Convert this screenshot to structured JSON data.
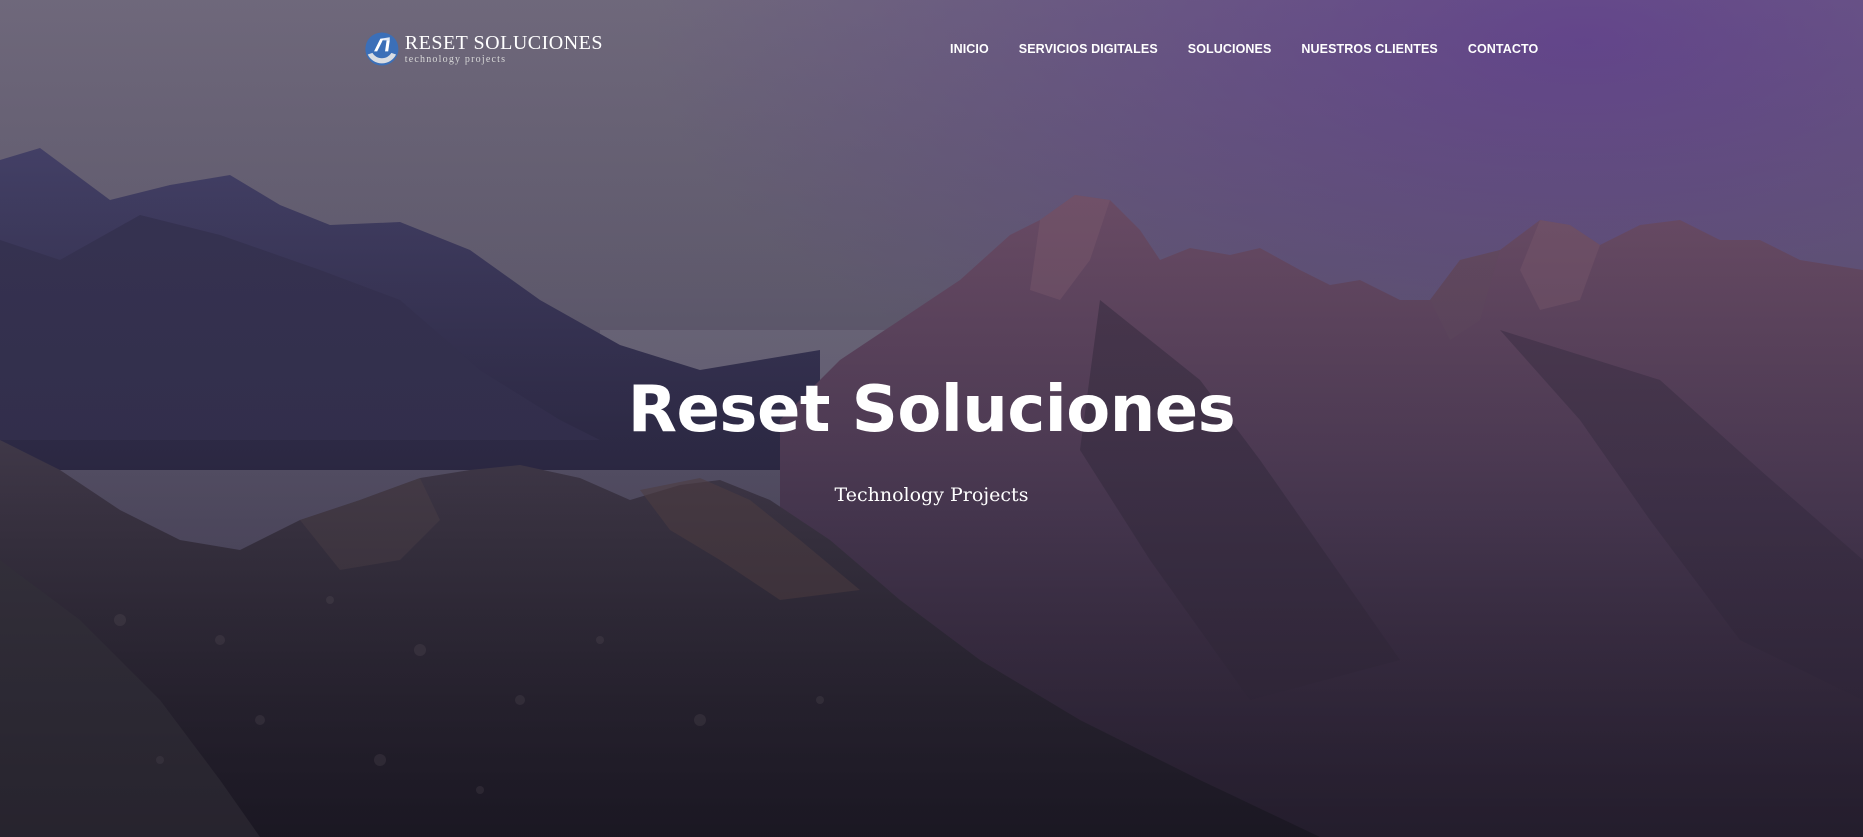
{
  "header": {
    "logo": {
      "name": "RESET SOLUCIONES",
      "tagline": "technology projects",
      "icon": "reset-logo-icon"
    },
    "nav": {
      "items": [
        {
          "label": "INICIO"
        },
        {
          "label": "SERVICIOS DIGITALES"
        },
        {
          "label": "SOLUCIONES"
        },
        {
          "label": "NUESTROS CLIENTES"
        },
        {
          "label": "CONTACTO"
        }
      ]
    }
  },
  "hero": {
    "title": "Reset Soluciones",
    "subtitle": "Technology Projects",
    "background": "mountain-landscape-image"
  },
  "colors": {
    "text": "#ffffff",
    "sky_top": "#7d7588",
    "sky_purple": "#5a4a8a",
    "mountain_dark": "#2c2636",
    "mountain_mauve": "#6a4e66"
  }
}
